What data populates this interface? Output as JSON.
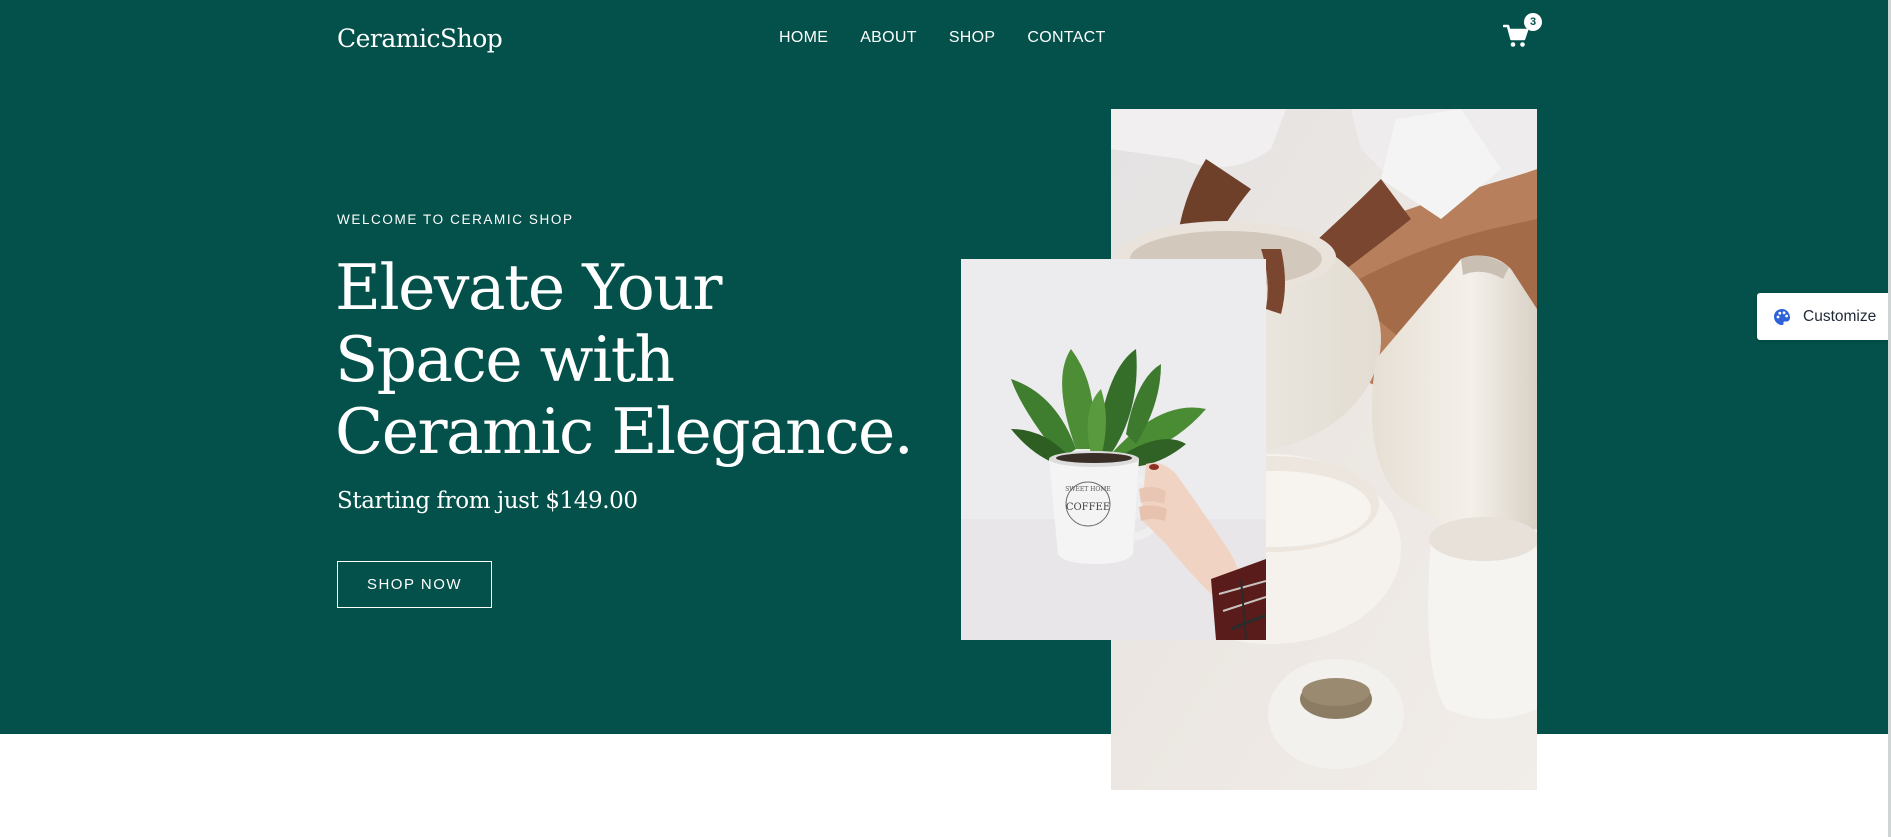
{
  "brand": "CeramicShop",
  "nav": {
    "items": [
      "HOME",
      "ABOUT",
      "SHOP",
      "CONTACT"
    ]
  },
  "cart": {
    "icon": "cart-icon",
    "count": "3"
  },
  "hero": {
    "eyebrow": "WELCOME TO CERAMIC SHOP",
    "headline_line1": "Elevate Your",
    "headline_line2": "Space with",
    "headline_line3": "Ceramic Elegance.",
    "subheadline": "Starting from just $149.00",
    "cta_label": "SHOP NOW"
  },
  "mug_print": {
    "line1": "SWEET HOME",
    "line2": "COFFEE"
  },
  "customize": {
    "icon": "palette-icon",
    "label": "Customize"
  },
  "colors": {
    "hero_bg": "#03514a",
    "text_light": "#ffffff",
    "page_bg": "#ffffff",
    "palette_accent": "#2e62d9"
  }
}
